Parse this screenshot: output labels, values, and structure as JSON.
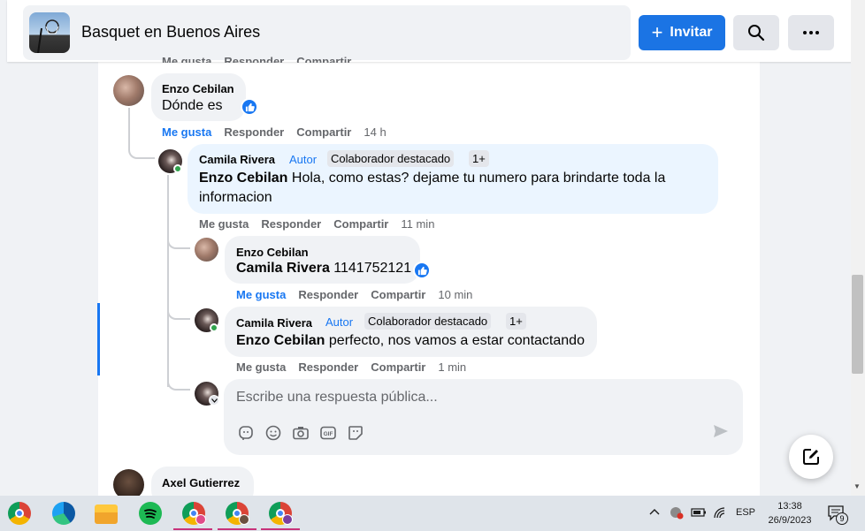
{
  "header": {
    "group_name": "Basquet en Buenos Aires",
    "invite_label": "Invitar"
  },
  "actions_labels": {
    "like": "Me gusta",
    "reply": "Responder",
    "share": "Compartir"
  },
  "comments": [
    {
      "author": "Enzo Cebilan",
      "text": "Dónde es",
      "liked_by_viewer": true,
      "has_like_reaction": true,
      "time": "14 h"
    },
    {
      "author": "Camila Rivera",
      "author_badge": "Autor",
      "tag": "Colaborador destacado",
      "tag_extra": "1+",
      "mention": "Enzo Cebilan",
      "text": "Hola, como estas? dejame tu numero para brindarte toda la informacion",
      "time": "11 min"
    },
    {
      "author": "Enzo Cebilan",
      "mention": "Camila Rivera",
      "text": "1141752121",
      "liked_by_viewer": true,
      "has_like_reaction": true,
      "time": "10 min"
    },
    {
      "author": "Camila Rivera",
      "author_badge": "Autor",
      "tag": "Colaborador destacado",
      "tag_extra": "1+",
      "mention": "Enzo Cebilan",
      "text": "perfecto, nos vamos a estar contactando",
      "time": "1 min"
    }
  ],
  "next_comment": {
    "author": "Axel Gutierrez"
  },
  "reply_box": {
    "placeholder": "Escribe una respuesta pública..."
  },
  "taskbar": {
    "language": "ESP",
    "time": "13:38",
    "date": "26/9/2023",
    "notification_count": "9"
  },
  "colors": {
    "accent": "#1877f2",
    "online": "#31a24c",
    "bubble": "#f0f2f5",
    "highlight_bubble": "#ebf5ff"
  }
}
